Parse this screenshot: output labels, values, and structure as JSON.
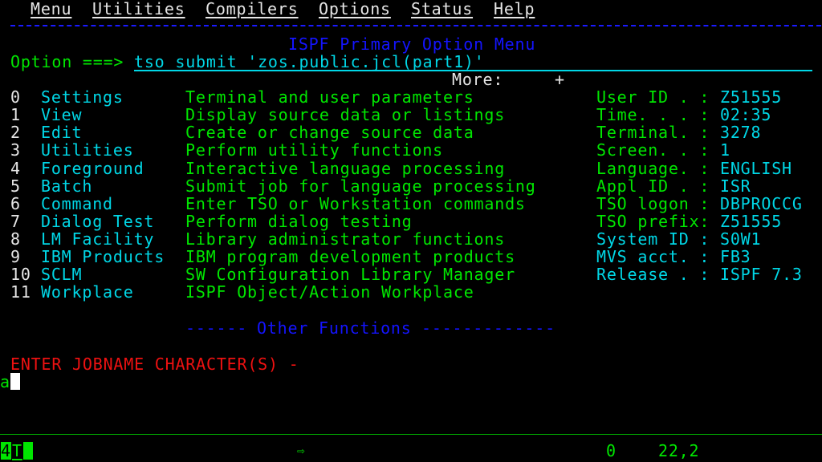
{
  "menubar": [
    {
      "label": "Menu",
      "hotkey": "M"
    },
    {
      "label": "Utilities",
      "hotkey": "U"
    },
    {
      "label": "Compilers",
      "hotkey": "C"
    },
    {
      "label": "Options",
      "hotkey": "O"
    },
    {
      "label": "Status",
      "hotkey": "S"
    },
    {
      "label": "Help",
      "hotkey": "H"
    }
  ],
  "panel": {
    "title": "ISPF Primary Option Menu",
    "option_prompt": "Option ===>",
    "option_value": "tso submit 'zos.public.jcl(part1)'",
    "more_label": "More:",
    "more_indicator": "+"
  },
  "options": [
    {
      "num": "0",
      "name": "Settings",
      "desc": "Terminal and user parameters"
    },
    {
      "num": "1",
      "name": "View",
      "desc": "Display source data or listings"
    },
    {
      "num": "2",
      "name": "Edit",
      "desc": "Create or change source data"
    },
    {
      "num": "3",
      "name": "Utilities",
      "desc": "Perform utility functions"
    },
    {
      "num": "4",
      "name": "Foreground",
      "desc": "Interactive language processing"
    },
    {
      "num": "5",
      "name": "Batch",
      "desc": "Submit job for language processing"
    },
    {
      "num": "6",
      "name": "Command",
      "desc": "Enter TSO or Workstation commands"
    },
    {
      "num": "7",
      "name": "Dialog Test",
      "desc": "Perform dialog testing"
    },
    {
      "num": "8",
      "name": "LM Facility",
      "desc": "Library administrator functions"
    },
    {
      "num": "9",
      "name": "IBM Products",
      "desc": "IBM program development products"
    },
    {
      "num": "10",
      "name": "SCLM",
      "desc": "SW Configuration Library Manager"
    },
    {
      "num": "11",
      "name": "Workplace",
      "desc": "ISPF Object/Action Workplace"
    }
  ],
  "sysinfo": [
    {
      "label": "User ID . :",
      "value": "Z51555",
      "label_color": "green"
    },
    {
      "label": "Time. . . :",
      "value": "02:35",
      "label_color": "green"
    },
    {
      "label": "Terminal. :",
      "value": "3278",
      "label_color": "green"
    },
    {
      "label": "Screen. . :",
      "value": "1",
      "label_color": "green"
    },
    {
      "label": "Language. :",
      "value": "ENGLISH",
      "label_color": "green"
    },
    {
      "label": "Appl ID . :",
      "value": "ISR",
      "label_color": "green"
    },
    {
      "label": "TSO logon :",
      "value": "DBPROCCG",
      "label_color": "green"
    },
    {
      "label": "TSO prefix:",
      "value": "Z51555",
      "label_color": "green"
    },
    {
      "label": "System ID :",
      "value": "S0W1",
      "label_color": "cyan"
    },
    {
      "label": "MVS acct. :",
      "value": "FB3",
      "label_color": "cyan"
    },
    {
      "label": "Release . :",
      "value": "ISPF 7.3",
      "label_color": "cyan"
    }
  ],
  "other_functions": {
    "left_dashes": "------",
    "label": "Other Functions",
    "right_dashes": "-------------"
  },
  "prompt": {
    "message": "ENTER JOBNAME CHARACTER(S) -",
    "input_value": "a"
  },
  "oia": {
    "session": "4",
    "mode": "T",
    "arrow_icon": "⇨",
    "field_value": "0",
    "cursor_pos": "22,2"
  },
  "colors": {
    "background": "#000000",
    "green": "#00e600",
    "cyan": "#00d7e6",
    "blue": "#1414ff",
    "red": "#ee1111",
    "white": "#e6e6e6"
  }
}
